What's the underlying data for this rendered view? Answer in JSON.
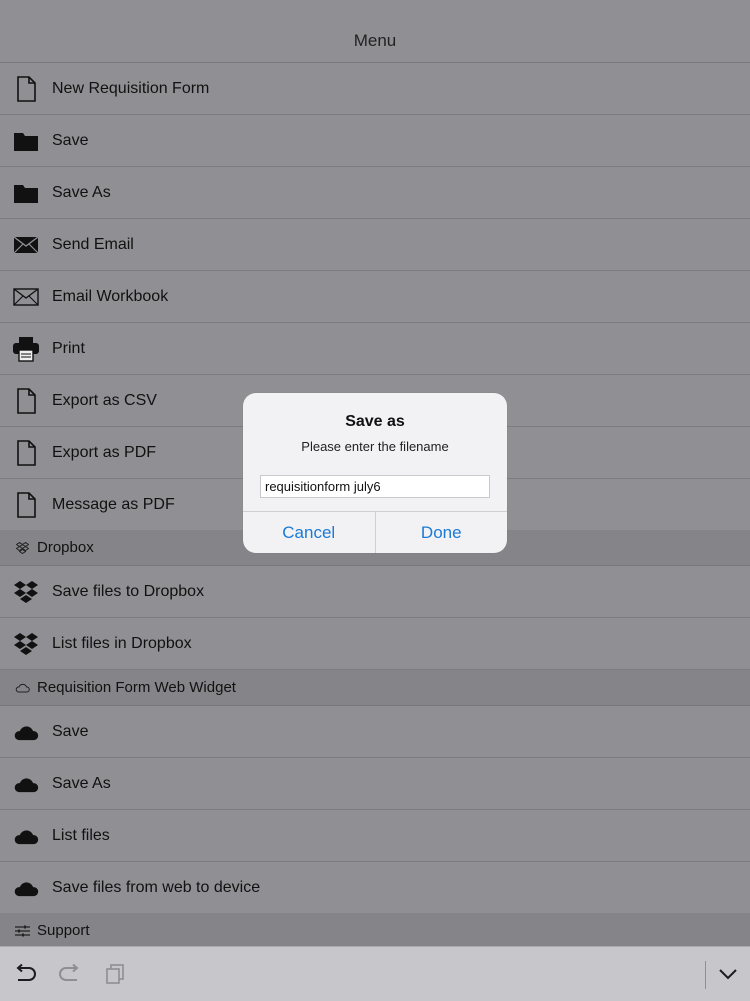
{
  "header": {
    "title": "Menu"
  },
  "menu_items": [
    {
      "label": "New Requisition Form",
      "icon": "document-icon"
    },
    {
      "label": "Save",
      "icon": "folder-icon"
    },
    {
      "label": "Save As",
      "icon": "folder-icon"
    },
    {
      "label": "Send Email",
      "icon": "envelope-filled-icon"
    },
    {
      "label": "Email Workbook",
      "icon": "envelope-outline-icon"
    },
    {
      "label": "Print",
      "icon": "printer-icon"
    },
    {
      "label": "Export as CSV",
      "icon": "document-icon"
    },
    {
      "label": "Export as PDF",
      "icon": "document-icon"
    },
    {
      "label": "Message as PDF",
      "icon": "document-icon"
    }
  ],
  "sections": {
    "dropbox": {
      "title": "Dropbox",
      "icon": "dropbox-small-icon",
      "items": [
        {
          "label": "Save files to Dropbox",
          "icon": "dropbox-icon"
        },
        {
          "label": "List files in Dropbox",
          "icon": "dropbox-icon"
        }
      ]
    },
    "web_widget": {
      "title": "Requisition Form Web Widget",
      "icon": "cloud-outline-icon",
      "items": [
        {
          "label": "Save",
          "icon": "cloud-icon"
        },
        {
          "label": "Save As",
          "icon": "cloud-icon"
        },
        {
          "label": "List files",
          "icon": "cloud-icon"
        },
        {
          "label": "Save files from web to device",
          "icon": "cloud-icon"
        }
      ]
    },
    "support": {
      "title": "Support",
      "icon": "sliders-icon"
    }
  },
  "dialog": {
    "title": "Save as",
    "message": "Please enter the filename",
    "filename_value": "requisitionform july6",
    "cancel_label": "Cancel",
    "done_label": "Done"
  },
  "toolbar": {
    "icons": [
      "undo-icon",
      "redo-icon",
      "copy-icon",
      "chevron-down-icon"
    ]
  },
  "colors": {
    "dimmed_background": "#908f93",
    "accent": "#1a7ad6",
    "dialog_background": "#f2f2f4"
  }
}
